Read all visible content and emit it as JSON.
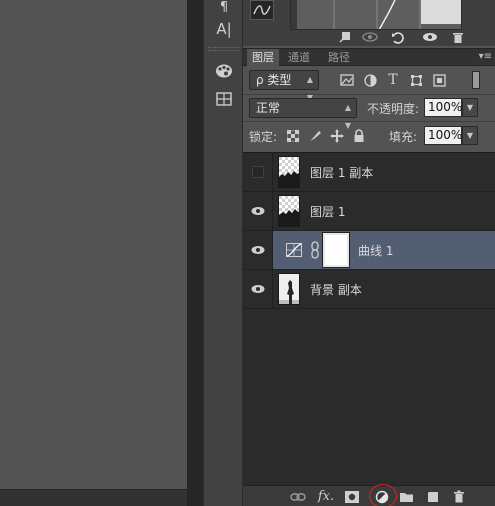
{
  "properties": {
    "footer_icons": [
      "clip-to-layer-icon",
      "view-previous-icon",
      "reset-icon",
      "visibility-icon",
      "delete-icon"
    ]
  },
  "tools": {
    "items": [
      "paragraph-icon",
      "character-icon",
      "swatches-icon",
      "grid-icon"
    ],
    "character_glyph": "A|",
    "paragraph_glyph": "¶"
  },
  "layers_panel": {
    "tabs": [
      {
        "label": "图层",
        "active": true
      },
      {
        "label": "通道",
        "active": false
      },
      {
        "label": "路径",
        "active": false
      }
    ],
    "filter": {
      "label": "ρ 类型",
      "type_letter": "T"
    },
    "blend_mode": "正常",
    "opacity_label": "不透明度:",
    "opacity_value": "100%",
    "lock_label": "锁定:",
    "fill_label": "填充:",
    "fill_value": "100%",
    "layers": [
      {
        "name": "图层 1 副本",
        "visible": false,
        "selected": false,
        "kind": "pixel"
      },
      {
        "name": "图层 1",
        "visible": true,
        "selected": false,
        "kind": "pixel"
      },
      {
        "name": "曲线 1",
        "visible": true,
        "selected": true,
        "kind": "adjustment"
      },
      {
        "name": "背景 副本",
        "visible": true,
        "selected": false,
        "kind": "photo"
      }
    ],
    "bottom_icons": [
      "link-layers-icon",
      "layer-style-icon",
      "add-mask-icon",
      "new-adjustment-layer-icon",
      "new-group-icon",
      "new-layer-icon",
      "delete-layer-icon"
    ],
    "fx_label": "fx."
  },
  "colors": {
    "panel_bg": "#535353",
    "layer_list_bg": "#2b2b2b",
    "selected_layer": "#535e72",
    "highlight": "#e02020"
  }
}
